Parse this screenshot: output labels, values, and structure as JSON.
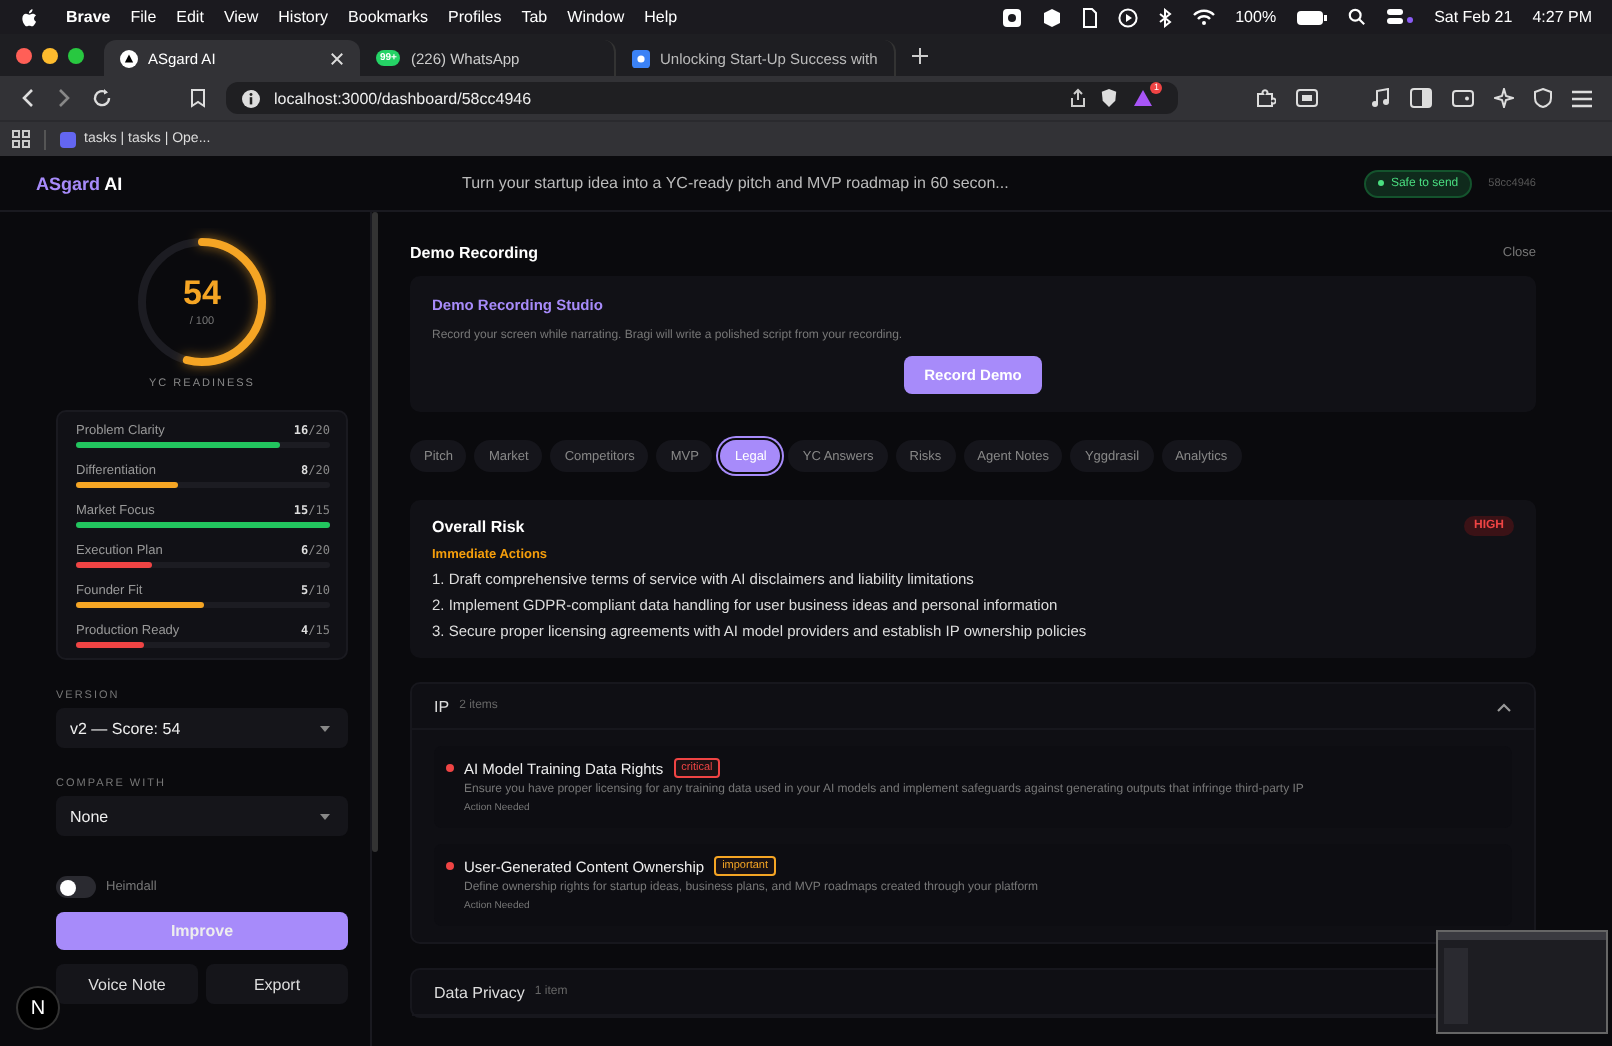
{
  "menubar": {
    "app": "Brave",
    "menus": [
      "File",
      "Edit",
      "View",
      "History",
      "Bookmarks",
      "Profiles",
      "Tab",
      "Window",
      "Help"
    ],
    "battery": "100%",
    "date": "Sat Feb 21",
    "time": "4:27 PM"
  },
  "browser_tabs": [
    {
      "title": "ASgard AI",
      "kind": "app",
      "selected": true
    },
    {
      "title": "(226) WhatsApp",
      "kind": "chat",
      "badge": "99+",
      "selected": false
    },
    {
      "title": "Unlocking Start-Up Success with",
      "kind": "doc",
      "selected": false
    }
  ],
  "address_bar": {
    "url": "localhost:3000/dashboard/58cc4946",
    "shield_badge": "1"
  },
  "bookmarks": [
    {
      "title": "tasks | tasks | Ope..."
    }
  ],
  "app_header": {
    "logo_main": "ASgard",
    "logo_accent": "AI",
    "tagline": "Turn your startup idea into a YC-ready pitch and MVP roadmap in 60 secon...",
    "status": "Safe to send",
    "id": "58cc4946"
  },
  "sidebar": {
    "score": {
      "value": "54",
      "max": "/ 100",
      "level": 0.54,
      "label": "YC READINESS"
    },
    "metrics": [
      {
        "name": "Problem Clarity",
        "score": "16",
        "max": "/20",
        "level": 0.8,
        "color": "#22c55e"
      },
      {
        "name": "Differentiation",
        "score": "8",
        "max": "/20",
        "level": 0.4,
        "color": "#f5a524"
      },
      {
        "name": "Market Focus",
        "score": "15",
        "max": "/15",
        "level": 1,
        "color": "#22c55e"
      },
      {
        "name": "Execution Plan",
        "score": "6",
        "max": "/20",
        "level": 0.3,
        "color": "#ef4444"
      },
      {
        "name": "Founder Fit",
        "score": "5",
        "max": "/10",
        "level": 0.5,
        "color": "#f5a524"
      },
      {
        "name": "Production Ready",
        "score": "4",
        "max": "/15",
        "level": 0.27,
        "color": "#ef4444"
      }
    ],
    "version": {
      "label": "VERSION",
      "value": "v2 — Score: 54"
    },
    "compare": {
      "label": "COMPARE WITH",
      "value": "None"
    },
    "heimdall": {
      "label": "Heimdall",
      "on": false
    },
    "improve": "Improve",
    "voice_note": "Voice Note",
    "export": "Export"
  },
  "dev_indicator": "N",
  "demo": {
    "title": "Demo Recording",
    "close": "Close",
    "studio_title": "Demo Recording Studio",
    "description": "Record your screen while narrating. Bragi will write a polished script from your recording.",
    "button": "Record Demo"
  },
  "section_tabs": [
    {
      "label": "Pitch",
      "selected": false
    },
    {
      "label": "Market",
      "selected": false
    },
    {
      "label": "Competitors",
      "selected": false
    },
    {
      "label": "MVP",
      "selected": false
    },
    {
      "label": "Legal",
      "selected": true
    },
    {
      "label": "YC Answers",
      "selected": false
    },
    {
      "label": "Risks",
      "selected": false
    },
    {
      "label": "Agent Notes",
      "selected": false
    },
    {
      "label": "Yggdrasil",
      "selected": false
    },
    {
      "label": "Analytics",
      "selected": false
    }
  ],
  "overall_risk": {
    "title": "Overall Risk",
    "badge": "HIGH",
    "actions_title": "Immediate Actions",
    "actions": [
      "1. Draft comprehensive terms of service with AI disclaimers and liability limitations",
      "2. Implement GDPR-compliant data handling for user business ideas and personal information",
      "3. Secure proper licensing agreements with AI model providers and establish IP ownership policies"
    ]
  },
  "sections": [
    {
      "title": "IP",
      "count": "2 items",
      "expanded": true,
      "items": [
        {
          "title": "AI Model Training Data Rights",
          "tag": "critical",
          "color": "#ef4444",
          "description": "Ensure you have proper licensing for any training data used in your AI models and implement safeguards against generating outputs that infringe third-party IP",
          "status": "Action Needed"
        },
        {
          "title": "User-Generated Content Ownership",
          "tag": "important",
          "color": "#f5a524",
          "description": "Define ownership rights for startup ideas, business plans, and MVP roadmaps created through your platform",
          "status": "Action Needed"
        }
      ]
    },
    {
      "title": "Data Privacy",
      "count": "1 item",
      "expanded": false
    }
  ]
}
